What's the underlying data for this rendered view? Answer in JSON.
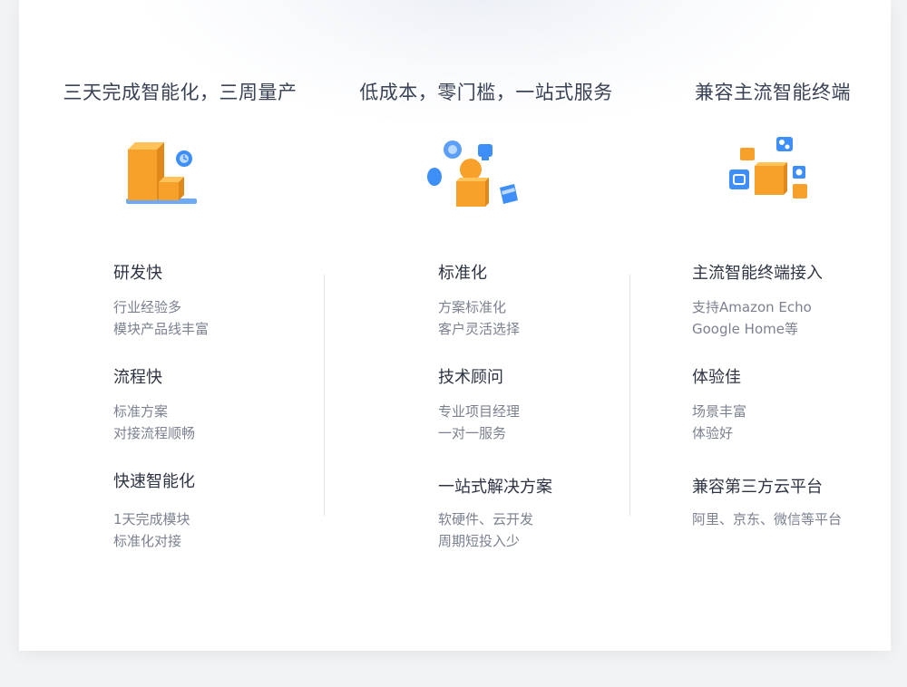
{
  "columns": [
    {
      "title": "三天完成智能化，三周量产",
      "icon": "delivery-boxes-icon",
      "features": [
        {
          "title": "研发快",
          "lines": [
            "行业经验多",
            "模块产品线丰富"
          ]
        },
        {
          "title": "流程快",
          "lines": [
            "标准方案",
            "对接流程顺畅"
          ]
        },
        {
          "title": "快速智能化",
          "lines": [
            "1天完成模块",
            "标准化对接"
          ]
        }
      ]
    },
    {
      "title": "低成本，零门槛，一站式服务",
      "icon": "service-support-icon",
      "features": [
        {
          "title": "标准化",
          "lines": [
            "方案标准化",
            "客户灵活选择"
          ]
        },
        {
          "title": "技术顾问",
          "lines": [
            "专业项目经理",
            "一对一服务"
          ]
        },
        {
          "title": "一站式解决方案",
          "lines": [
            "软硬件、云开发",
            "周期短投入少"
          ]
        }
      ]
    },
    {
      "title": "兼容主流智能终端",
      "icon": "smart-devices-icon",
      "features": [
        {
          "title": "主流智能终端接入",
          "lines": [
            "支持Amazon Echo",
            "Google Home等"
          ]
        },
        {
          "title": "体验佳",
          "lines": [
            "场景丰富",
            "体验好"
          ]
        },
        {
          "title": "兼容第三方云平台",
          "lines": [
            "阿里、京东、微信等平台"
          ]
        }
      ]
    }
  ],
  "colors": {
    "orange": "#f7a12b",
    "blue": "#3e8ef7",
    "title": "#3a4256",
    "text": "#7b8190"
  }
}
